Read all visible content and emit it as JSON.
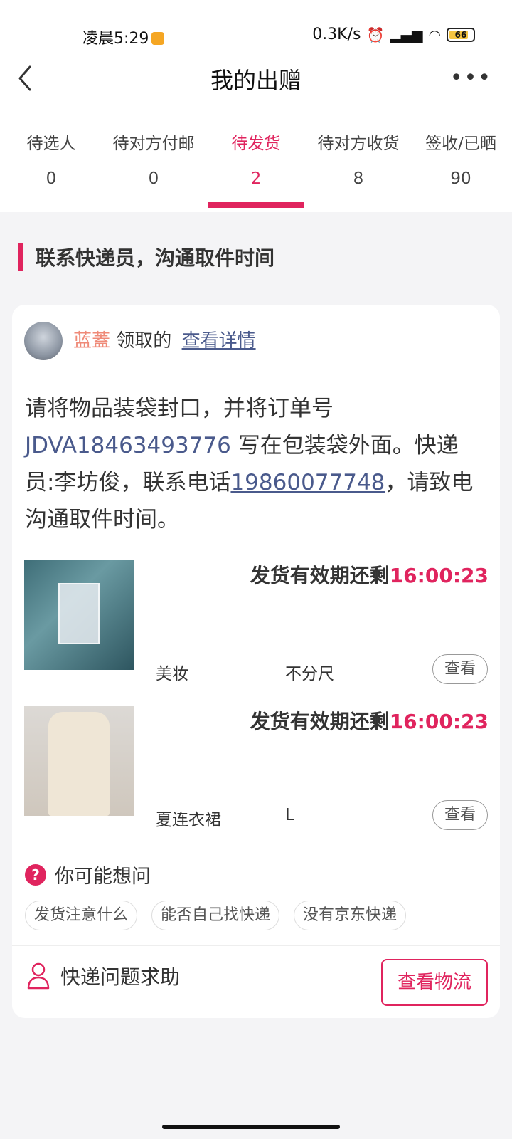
{
  "status_bar": {
    "time": "凌晨5:29",
    "network_speed": "0.3K/s",
    "battery": "66"
  },
  "header": {
    "title": "我的出赠"
  },
  "tabs": [
    {
      "label": "待选人",
      "count": "0"
    },
    {
      "label": "待对方付邮",
      "count": "0"
    },
    {
      "label": "待发货",
      "count": "2"
    },
    {
      "label": "待对方收货",
      "count": "8"
    },
    {
      "label": "签收/已晒",
      "count": "90"
    }
  ],
  "active_tab": "待发货",
  "section": {
    "title": "联系快递员，沟通取件时间"
  },
  "claim": {
    "claimer": "蓝蓋",
    "action": "领取的",
    "detail_link": "查看详情"
  },
  "instructions": {
    "part1": "请将物品装袋封口，并将订单号 ",
    "order_no": "JDVA18463493776",
    "part2": " 写在包装袋外面。快递员:李坊俊，联系电话",
    "phone": "19860077748",
    "part3": "，请致电沟通取件时间。"
  },
  "items": [
    {
      "deadline_label": "发货有效期还剩",
      "countdown": "16:00:23",
      "category": "美妆",
      "size": "不分尺",
      "view_label": "查看"
    },
    {
      "deadline_label": "发货有效期还剩",
      "countdown": "16:00:23",
      "category": "夏连衣裙",
      "size": "L",
      "view_label": "查看"
    }
  ],
  "faq": {
    "title": "你可能想问",
    "chips": [
      "发货注意什么",
      "能否自己找快递",
      "没有京东快递"
    ]
  },
  "footer": {
    "help_label": "快递问题求助",
    "logistics_button": "查看物流"
  },
  "colors": {
    "accent": "#e0245e",
    "link": "#4a5a8c",
    "claimer": "#ef8a78"
  }
}
